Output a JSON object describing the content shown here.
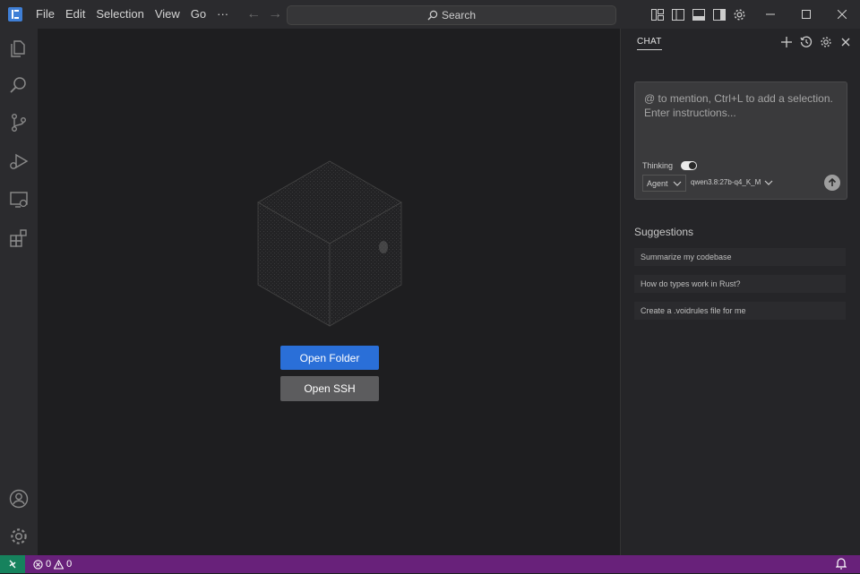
{
  "menu": {
    "items": [
      "File",
      "Edit",
      "Selection",
      "View",
      "Go",
      "···"
    ]
  },
  "search": {
    "label": "Search"
  },
  "welcome": {
    "open_folder_label": "Open Folder",
    "open_ssh_label": "Open SSH"
  },
  "chat": {
    "tab_label": "CHAT",
    "input_placeholder": "@ to mention, Ctrl+L to add a selection. Enter instructions...",
    "thinking_label": "Thinking",
    "thinking_enabled": true,
    "mode_label": "Agent",
    "model_label": "qwen3.8:27b-q4_K_M",
    "suggestions_title": "Suggestions",
    "suggestions": [
      "Summarize my codebase",
      "How do types work in Rust?",
      "Create a .voidrules file for me"
    ]
  },
  "status": {
    "errors": "0",
    "warnings": "0"
  },
  "colors": {
    "status_bar": "#68217a",
    "remote_button": "#16825d",
    "primary_button": "#2a6fd8"
  }
}
